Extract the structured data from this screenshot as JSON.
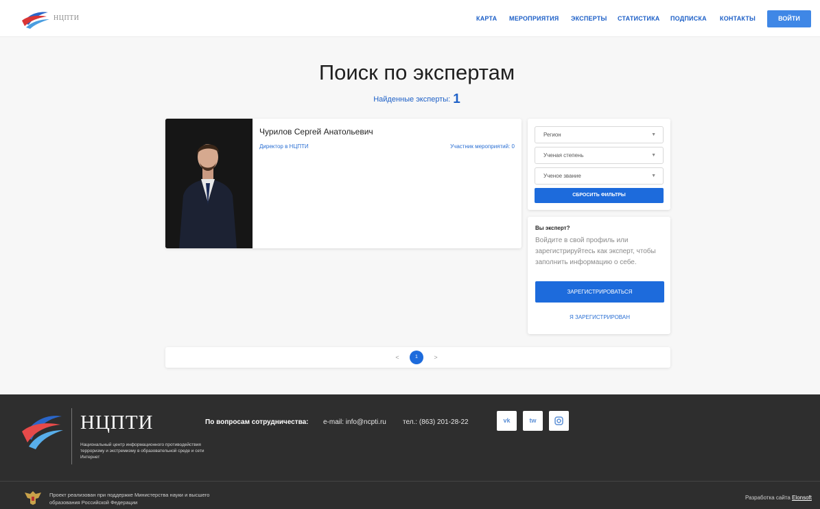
{
  "header": {
    "logo_text": "НЦПТИ",
    "nav": [
      "КАРТА",
      "МЕРОПРИЯТИЯ",
      "ЭКСПЕРТЫ",
      "СТАТИСТИКА",
      "ПОДПИСКА",
      "КОНТАКТЫ"
    ],
    "login_label": "ВОЙТИ"
  },
  "main": {
    "title": "Поиск по экспертам",
    "found_label": "Найденные эксперты:",
    "found_count": "1"
  },
  "expert": {
    "name": "Чурилов Сергей Анатольевич",
    "position": "Директор в НЦПТИ",
    "events": "Участник мероприятий: 0"
  },
  "filters": {
    "region": "Регион",
    "degree": "Ученая степень",
    "title": "Ученое звание",
    "reset_label": "СБРОСИТЬ ФИЛЬТРЫ"
  },
  "expert_box": {
    "question": "Вы эксперт?",
    "description": "Войдите в свой профиль или зарегистрируйтесь как эксперт, чтобы заполнить информацию о себе.",
    "register_label": "ЗАРЕГИСТРИРОВАТЬСЯ",
    "registered_label": "Я ЗАРЕГИСТРИРОВАН"
  },
  "pagination": {
    "prev": "<",
    "current": "1",
    "next": ">"
  },
  "footer": {
    "brand": "НЦПТИ",
    "description": "Национальный центр информационного противодействия терроризму и экстремизму в образовательной среде и сети Интернет",
    "coop_label": "По вопросам сотрудничества:",
    "email": "e-mail: info@ncpti.ru",
    "phone": "тел.: (863) 201-28-22",
    "social": [
      "vk",
      "tw",
      "ig"
    ],
    "support": "Проект реализован при поддержке Министерства науки и высшего образования Российской Федерации",
    "dev_label": "Разработка сайта",
    "dev_link": "Elonsoft"
  },
  "colors": {
    "accent": "#1d6bdc",
    "login": "#3f87e6",
    "footer_bg": "#2e2e2e"
  }
}
